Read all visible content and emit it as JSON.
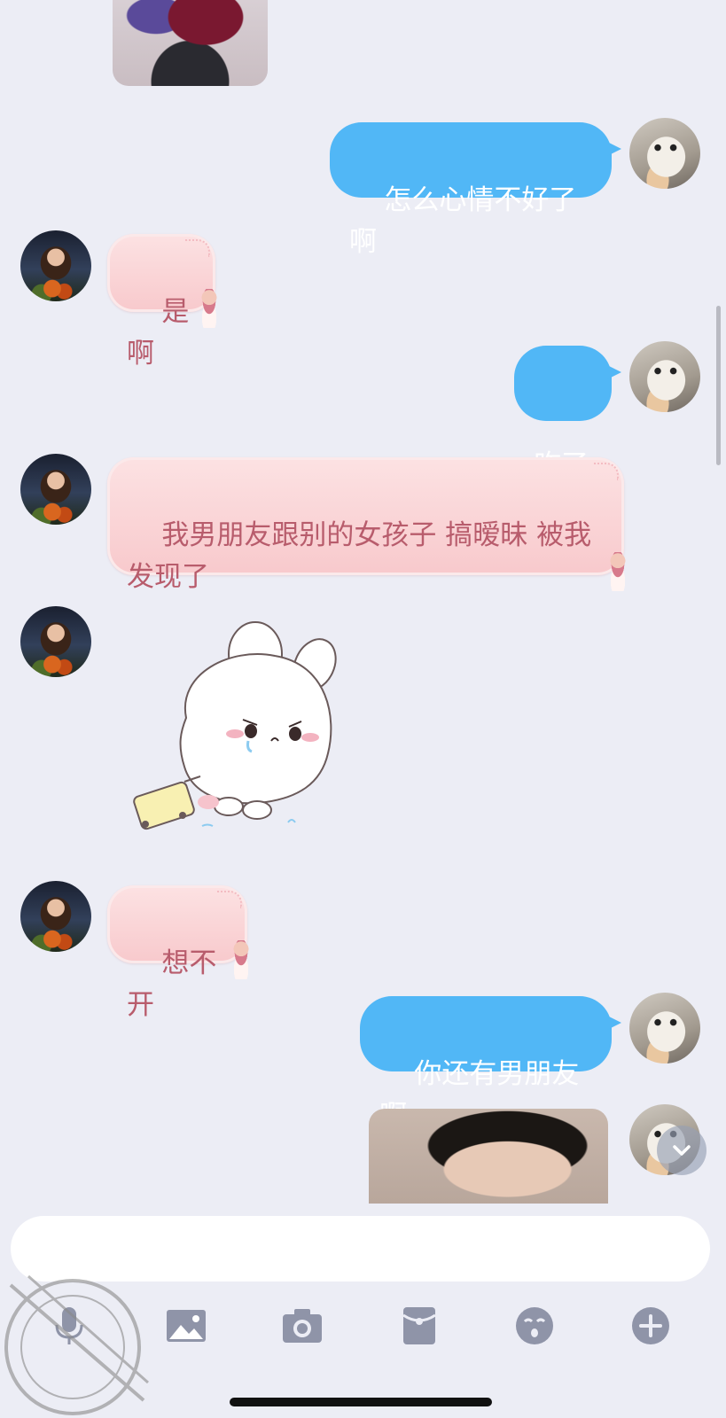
{
  "chat": {
    "messages": [
      {
        "side": "right",
        "type": "text",
        "text": "怎么心情不好了啊"
      },
      {
        "side": "left",
        "type": "text",
        "text": "是啊"
      },
      {
        "side": "right",
        "type": "text",
        "text": "咋了"
      },
      {
        "side": "left",
        "type": "text",
        "text": "我男朋友跟别的女孩子 搞暧昧 被我\n发现了"
      },
      {
        "side": "left",
        "type": "sticker",
        "sticker": "crying-bunny-with-suitcase"
      },
      {
        "side": "left",
        "type": "text",
        "text": "想不开"
      },
      {
        "side": "right",
        "type": "text",
        "text": "你还有男朋友啊"
      },
      {
        "side": "right",
        "type": "image"
      }
    ]
  },
  "composer": {
    "input_value": "",
    "tools": [
      "microphone-icon",
      "image-icon",
      "camera-icon",
      "red-packet-icon",
      "emoji-icon",
      "plus-icon"
    ]
  },
  "colors": {
    "background": "#ECEDF5",
    "outgoing_bubble": "#51B7F6",
    "incoming_bubble": "#F8C9CC",
    "incoming_text": "#B85C6C",
    "icon": "#8F94A8"
  }
}
